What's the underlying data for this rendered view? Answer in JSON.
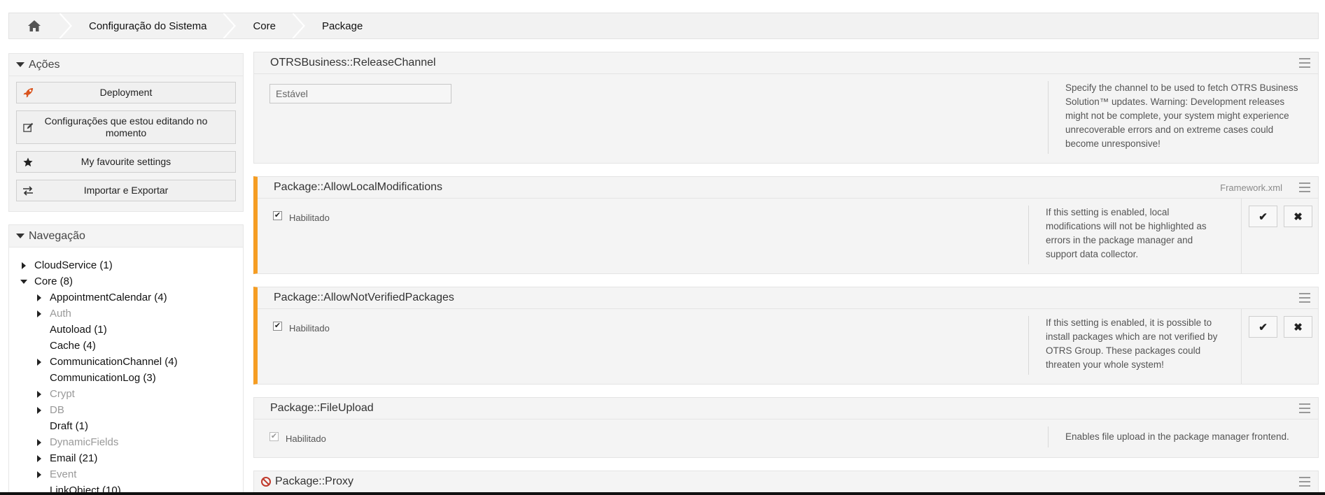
{
  "breadcrumb": {
    "items": [
      "Configuração do Sistema",
      "Core",
      "Package"
    ]
  },
  "sidebar": {
    "actions": {
      "title": "Ações",
      "buttons": [
        {
          "label": "Deployment",
          "icon": "rocket-icon"
        },
        {
          "label": "Configurações que estou editando no momento",
          "icon": "edit-icon"
        },
        {
          "label": "My favourite settings",
          "icon": "star-icon"
        },
        {
          "label": "Importar e Exportar",
          "icon": "exchange-icon"
        }
      ]
    },
    "navigation": {
      "title": "Navegação",
      "items": [
        {
          "label": "CloudService (1)",
          "level": 1,
          "toggle": "collapsed",
          "disabled": false
        },
        {
          "label": "Core (8)",
          "level": 1,
          "toggle": "expanded",
          "disabled": false
        },
        {
          "label": "AppointmentCalendar (4)",
          "level": 2,
          "toggle": "collapsed",
          "disabled": false
        },
        {
          "label": "Auth",
          "level": 2,
          "toggle": "collapsed",
          "disabled": true
        },
        {
          "label": "Autoload (1)",
          "level": 2,
          "toggle": "none",
          "disabled": false
        },
        {
          "label": "Cache (4)",
          "level": 2,
          "toggle": "none",
          "disabled": false
        },
        {
          "label": "CommunicationChannel (4)",
          "level": 2,
          "toggle": "collapsed",
          "disabled": false
        },
        {
          "label": "CommunicationLog (3)",
          "level": 2,
          "toggle": "none",
          "disabled": false
        },
        {
          "label": "Crypt",
          "level": 2,
          "toggle": "collapsed",
          "disabled": true
        },
        {
          "label": "DB",
          "level": 2,
          "toggle": "collapsed",
          "disabled": true
        },
        {
          "label": "Draft (1)",
          "level": 2,
          "toggle": "none",
          "disabled": false
        },
        {
          "label": "DynamicFields",
          "level": 2,
          "toggle": "collapsed",
          "disabled": true
        },
        {
          "label": "Email (21)",
          "level": 2,
          "toggle": "collapsed",
          "disabled": false
        },
        {
          "label": "Event",
          "level": 2,
          "toggle": "collapsed",
          "disabled": true
        },
        {
          "label": "LinkObject (10)",
          "level": 2,
          "toggle": "none",
          "disabled": false
        }
      ]
    }
  },
  "settings": [
    {
      "name": "OTRSBusiness::ReleaseChannel",
      "value": "Estável",
      "description": "Specify the channel to be used to fetch OTRS Business Solution™ updates. Warning: Development releases might not be complete, your system might experience unrecoverable errors and on extreme cases could become unresponsive!"
    },
    {
      "name": "Package::AllowLocalModifications",
      "file": "Framework.xml",
      "checkbox_label": "Habilitado",
      "description": "If this setting is enabled, local modifications will not be highlighted as errors in the package manager and support data collector.",
      "save_symbol": "✔",
      "cancel_symbol": "✖"
    },
    {
      "name": "Package::AllowNotVerifiedPackages",
      "checkbox_label": "Habilitado",
      "description": "If this setting is enabled, it is possible to install packages which are not verified by OTRS Group. These packages could threaten your whole system!",
      "save_symbol": "✔",
      "cancel_symbol": "✖"
    },
    {
      "name": "Package::FileUpload",
      "checkbox_label": "Habilitado",
      "description": "Enables file upload in the package manager frontend."
    },
    {
      "name": "Package::Proxy"
    }
  ],
  "colors": {
    "modified_accent": "#f59d23",
    "invalid": "#c0392b",
    "rocket": "#d9541e"
  }
}
